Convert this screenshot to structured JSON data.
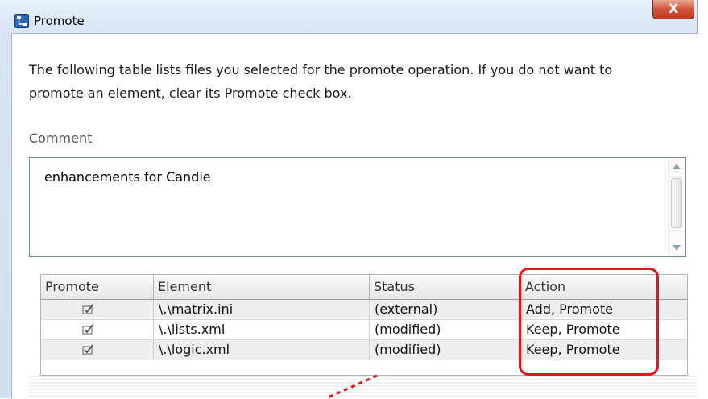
{
  "window": {
    "title": "Promote",
    "close_label": "X"
  },
  "description": "The following table lists files you selected for the promote operation. If you do not want to promote an element, clear its Promote check box.",
  "comment": {
    "label": "Comment",
    "value": "enhancements for Candle"
  },
  "table": {
    "columns": [
      "Promote",
      "Element",
      "Status",
      "Action"
    ],
    "rows": [
      {
        "promote": true,
        "element": "\\.\\matrix.ini",
        "status": "(external)",
        "action": "Add, Promote"
      },
      {
        "promote": true,
        "element": "\\.\\lists.xml",
        "status": "(modified)",
        "action": "Keep, Promote"
      },
      {
        "promote": true,
        "element": "\\.\\logic.xml",
        "status": "(modified)",
        "action": "Keep, Promote"
      }
    ]
  },
  "colors": {
    "highlight": "#e8141b",
    "close_button": "#d2543b"
  },
  "icons": {
    "app": "promote-app-icon",
    "check": "checkmark-icon"
  }
}
